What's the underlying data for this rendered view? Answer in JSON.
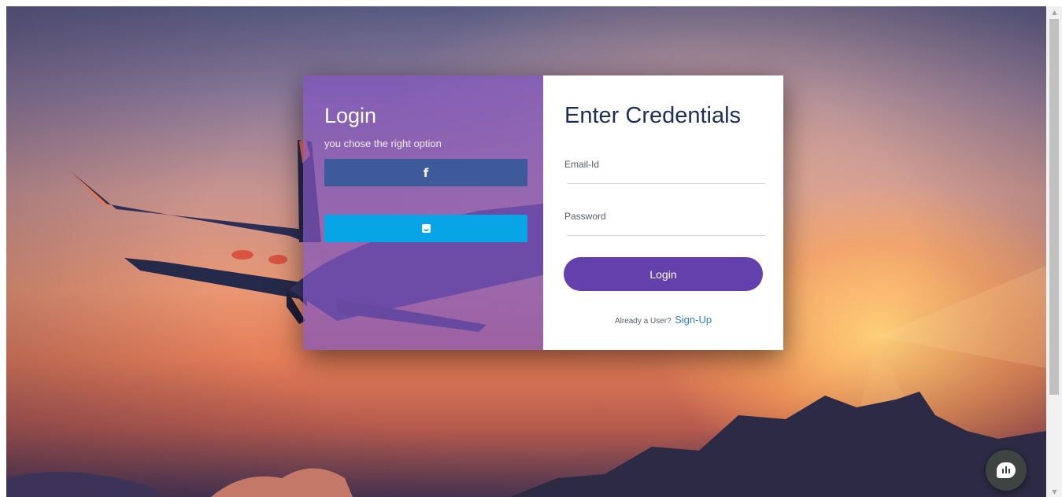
{
  "left_panel": {
    "title": "Login",
    "subtitle": "you chose the right option",
    "facebook_icon": "facebook-icon",
    "facebook_glyph": "f",
    "twitter_icon": "twitter-icon"
  },
  "right_panel": {
    "title": "Enter Credentials",
    "email_label": "Email-Id",
    "email_value": "",
    "password_label": "Password",
    "password_value": "",
    "login_button": "Login",
    "signup_prompt": "Already a User?",
    "signup_link": "Sign-Up"
  },
  "chat_widget": {
    "icon": "chat-bubble-icon"
  },
  "colors": {
    "left_overlay": "#8054be",
    "facebook": "#3e5a9a",
    "twitter": "#07a5e6",
    "login_button": "#6440ad",
    "title_text": "#1e2e5a",
    "link": "#2f7ad6"
  }
}
